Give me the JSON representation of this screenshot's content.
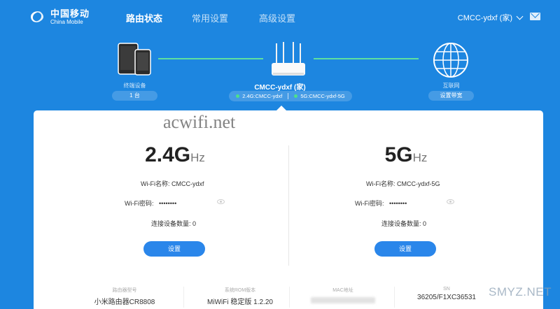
{
  "brand": {
    "cn": "中国移动",
    "en": "China Mobile",
    "color": "#1d86e0"
  },
  "nav": {
    "tabs": [
      {
        "label": "路由状态",
        "active": true
      },
      {
        "label": "常用设置",
        "active": false
      },
      {
        "label": "高级设置",
        "active": false
      }
    ]
  },
  "user": {
    "name": "CMCC-ydxf (家)",
    "icon": "chevron-down-icon"
  },
  "mail": {
    "icon": "mail-icon"
  },
  "topology": {
    "terminal": {
      "label": "终端设备",
      "count": "1 台",
      "icon": "devices-icon"
    },
    "router": {
      "name": "CMCC-ydxf (家)",
      "ssid_24": "2.4G:CMCC-ydxf",
      "ssid_5": "5G:CMCC-ydxf-5G",
      "icon": "router-icon"
    },
    "internet": {
      "label": "互联网",
      "action": "设置带宽",
      "icon": "globe-icon"
    }
  },
  "watermark": "acwifi.net",
  "bands": [
    {
      "big": "2.4G",
      "unit": "Hz",
      "wifi_name_label": "Wi-Fi名称:",
      "wifi_name": "CMCC-ydxf",
      "wifi_pwd_label": "Wi-Fi密码:",
      "wifi_pwd": "••••••••",
      "connected_label": "连接设备数量:",
      "connected": "0",
      "button": "设置"
    },
    {
      "big": "5G",
      "unit": "Hz",
      "wifi_name_label": "Wi-Fi名称:",
      "wifi_name": "CMCC-ydxf-5G",
      "wifi_pwd_label": "Wi-Fi密码:",
      "wifi_pwd": "••••••••",
      "connected_label": "连接设备数量:",
      "connected": "0",
      "button": "设置"
    }
  ],
  "info": {
    "model_label": "路由器型号",
    "model": "小米路由器CR8808",
    "rom_label": "系统ROM版本",
    "rom": "MiWiFi 稳定版 1.2.20",
    "mac_label": "MAC地址",
    "sn_label": "SN",
    "sn": "36205/F1XC36531"
  },
  "corner_watermark": "SMYZ.NET"
}
